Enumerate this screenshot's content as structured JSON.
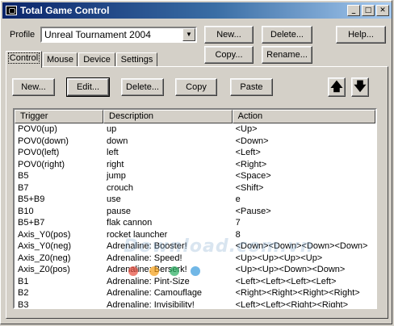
{
  "window": {
    "title": "Total Game Control"
  },
  "titlebar_buttons": {
    "minimize": "_",
    "maximize": "□",
    "close": "✕"
  },
  "profile": {
    "label": "Profile",
    "selected": "Unreal Tournament 2004"
  },
  "profile_buttons": {
    "new": "New...",
    "delete": "Delete...",
    "help": "Help...",
    "copy": "Copy...",
    "rename": "Rename..."
  },
  "tabs": [
    "Control",
    "Mouse",
    "Device",
    "Settings"
  ],
  "toolbar": {
    "new": "New...",
    "edit": "Edit...",
    "delete": "Delete...",
    "copy": "Copy",
    "paste": "Paste",
    "up_glyph": "🡅",
    "down_glyph": "🡇"
  },
  "table": {
    "columns": [
      "Trigger",
      "Description",
      "Action"
    ],
    "rows": [
      [
        "POV0(up)",
        "up",
        "<Up>"
      ],
      [
        "POV0(down)",
        "down",
        "<Down>"
      ],
      [
        "POV0(left)",
        "left",
        "<Left>"
      ],
      [
        "POV0(right)",
        "right",
        "<Right>"
      ],
      [
        "B5",
        "jump",
        "<Space>"
      ],
      [
        "B7",
        "crouch",
        "<Shift>"
      ],
      [
        "B5+B9",
        "use",
        "e"
      ],
      [
        "B10",
        "pause",
        "<Pause>"
      ],
      [
        "B5+B7",
        "flak cannon",
        "7"
      ],
      [
        "Axis_Y0(pos)",
        "rocket launcher",
        "8"
      ],
      [
        "Axis_Y0(neg)",
        "Adrenaline: Booster!",
        "<Down><Down><Down><Down>"
      ],
      [
        "Axis_Z0(neg)",
        "Adrenaline: Speed!",
        "<Up><Up><Up><Up>"
      ],
      [
        "Axis_Z0(pos)",
        "Adrenaline: Berserk!",
        "<Up><Up><Down><Down>"
      ],
      [
        "B1",
        "Adrenaline: Pint-Size",
        "<Left><Left><Left><Left>"
      ],
      [
        "B2",
        "Adrenaline: Camouflage",
        "<Right><Right><Right><Right>"
      ],
      [
        "B3",
        "Adrenaline: Invisibility!",
        "<Left><Left><Right><Right>"
      ]
    ]
  },
  "watermark": {
    "text": "Download.com.vn"
  }
}
